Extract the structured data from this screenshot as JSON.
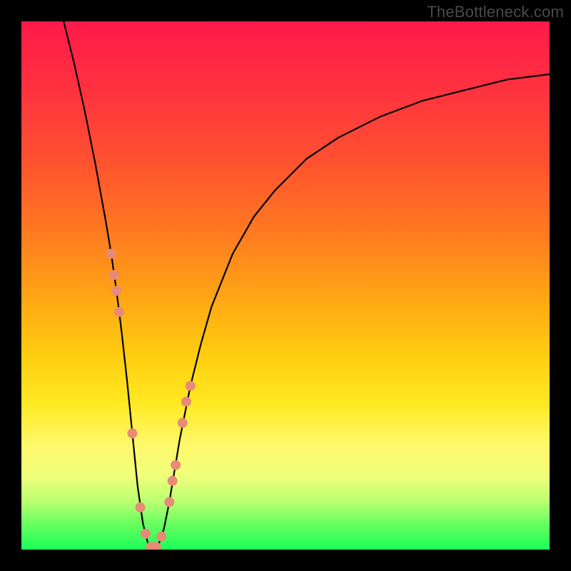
{
  "watermark": "TheBottleneck.com",
  "chart_data": {
    "type": "line",
    "title": "",
    "xlabel": "",
    "ylabel": "",
    "xlim": [
      0,
      100
    ],
    "ylim": [
      0,
      100
    ],
    "grid": false,
    "series": [
      {
        "name": "bottleneck-curve",
        "x": [
          8,
          10,
          12,
          14,
          16,
          17,
          18,
          19,
          20,
          21,
          22,
          23,
          24,
          25,
          26,
          27,
          28,
          29,
          30,
          32,
          34,
          36,
          40,
          44,
          48,
          54,
          60,
          68,
          76,
          84,
          92,
          100
        ],
        "y": [
          100,
          92,
          83,
          73,
          62,
          56,
          49,
          41,
          32,
          22,
          12,
          5,
          1,
          0,
          1,
          4,
          9,
          15,
          21,
          31,
          39,
          46,
          56,
          63,
          68,
          74,
          78,
          82,
          85,
          87,
          89,
          90
        ]
      }
    ],
    "markers": {
      "name": "highlight-dots",
      "x": [
        17.0,
        17.5,
        18.0,
        18.5,
        21.0,
        22.5,
        23.5,
        24.5,
        25.5,
        26.5,
        28.0,
        28.6,
        29.2,
        30.5,
        31.2,
        32.0
      ],
      "y": [
        56,
        52,
        49,
        45,
        22,
        8,
        3,
        0.5,
        0.5,
        2.5,
        9,
        13,
        16,
        24,
        28,
        31
      ]
    }
  },
  "colors": {
    "curve": "#000000",
    "dots": "#e88a78"
  }
}
